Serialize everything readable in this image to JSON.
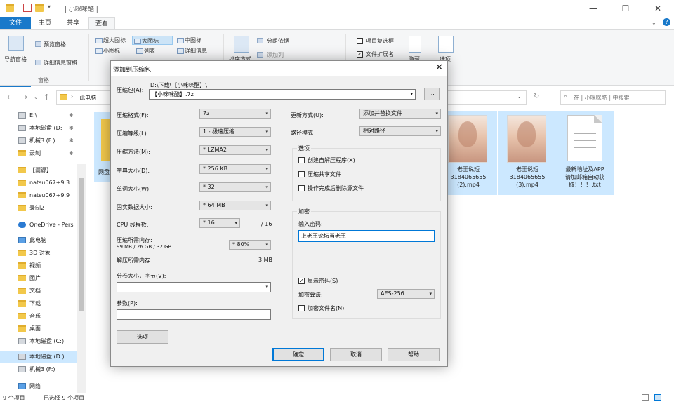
{
  "window": {
    "title": "| 小咪咪酷 |",
    "minimize": "—",
    "maximize": "☐",
    "close": "✕"
  },
  "ribbon": {
    "tabs": [
      "文件",
      "主页",
      "共享",
      "查看"
    ],
    "nav_pane_label": "导航窗格",
    "preview_pane": "预览窗格",
    "details_pane": "详细信息窗格",
    "panes_group": "窗格",
    "layout_items": [
      "超大图标",
      "大图标",
      "中图标",
      "小图标",
      "列表",
      "详细信息"
    ],
    "sort_by": "排序方式",
    "group_by": "分组依据",
    "add_columns": "添加列",
    "item_checkboxes": "项目复选框",
    "file_extensions": "文件扩展名",
    "hide": "隐藏",
    "options": "选项"
  },
  "addressbar": {
    "path_root": "此电脑",
    "search_placeholder": "在 | 小咪咪酷 | 中搜索"
  },
  "nav_pane": {
    "items": [
      {
        "label": "E:\\",
        "icon": "drive-icon"
      },
      {
        "label": "本地磁盘 (D:",
        "icon": "drive-icon"
      },
      {
        "label": "机械3 (F:)",
        "icon": "drive-icon"
      },
      {
        "label": "录制",
        "icon": "folder-icon"
      },
      {
        "label": "【鬻源】",
        "icon": "folder-icon"
      },
      {
        "label": "natsu067+9.3",
        "icon": "folder-icon"
      },
      {
        "label": "natsu067+9.9",
        "icon": "folder-icon"
      },
      {
        "label": "录制2",
        "icon": "folder-icon"
      },
      {
        "label": "OneDrive - Pers",
        "icon": "cloud-icon"
      },
      {
        "label": "此电脑",
        "icon": "pc-icon"
      },
      {
        "label": "3D 对象",
        "icon": "folder-icon"
      },
      {
        "label": "视频",
        "icon": "folder-icon"
      },
      {
        "label": "图片",
        "icon": "folder-icon"
      },
      {
        "label": "文档",
        "icon": "folder-icon"
      },
      {
        "label": "下载",
        "icon": "folder-icon"
      },
      {
        "label": "音乐",
        "icon": "folder-icon"
      },
      {
        "label": "桌面",
        "icon": "folder-icon"
      },
      {
        "label": "本地磁盘 (C:)",
        "icon": "drive-icon"
      },
      {
        "label": "本地磁盘 (D:)",
        "icon": "drive-icon"
      },
      {
        "label": "机械3 (F:)",
        "icon": "drive-icon"
      },
      {
        "label": "网络",
        "icon": "network-icon"
      }
    ]
  },
  "files": [
    {
      "name": "网盘",
      "type": "folder"
    },
    {
      "name": "老王说短3184065655(2).mp4",
      "line1": "老王说短",
      "line2": "3184065655",
      "line3": "(2).mp4",
      "type": "video"
    },
    {
      "name": "老王说短3184065655(3).mp4",
      "line1": "老王说短",
      "line2": "3184065655",
      "line3": "(3).mp4",
      "type": "video"
    },
    {
      "name": "最新地址及APP请加邮箱自动获取！！！.txt",
      "line1": "最新地址及APP",
      "line2": "请加邮箱自动获",
      "line3": "取！！！.txt",
      "type": "text"
    }
  ],
  "statusbar": {
    "count": "9 个项目",
    "selected": "已选择 9 个项目"
  },
  "dialog": {
    "title": "添加到压缩包",
    "close": "✕",
    "archive_label": "压缩包(A):",
    "archive_path": "D:\\下载\\【小咪咪酷】\\",
    "archive_name": "【小咪咪酷】.7z",
    "browse": "...",
    "format_label": "压缩格式(F):",
    "format_value": "7z",
    "level_label": "压缩等级(L):",
    "level_value": "1 - 极速压缩",
    "method_label": "压缩方法(M):",
    "method_value": "* LZMA2",
    "dict_label": "字典大小(D):",
    "dict_value": "* 256 KB",
    "word_label": "单词大小(W):",
    "word_value": "* 32",
    "solid_label": "固实数据大小:",
    "solid_value": "* 64 MB",
    "cpu_label": "CPU 线程数:",
    "cpu_value": "* 16",
    "cpu_total": "/ 16",
    "mem_label": "压缩所需内存:",
    "mem_detail": "99 MB / 26 GB / 32 GB",
    "mem_value": "* 80%",
    "decomp_label": "解压所需内存:",
    "decomp_value": "3 MB",
    "split_label": "分卷大小，字节(V):",
    "params_label": "参数(P):",
    "options_btn": "选项",
    "update_label": "更新方式(U):",
    "update_value": "添加并替换文件",
    "path_label": "路径模式",
    "path_value": "相对路径",
    "options_group": "选项",
    "opt_sfx": "创建自解压程序(X)",
    "opt_shared": "压缩共享文件",
    "opt_delete": "操作完成后删除源文件",
    "encrypt_group": "加密",
    "pwd_label": "输入密码:",
    "pwd_value": "上老王论坛当老王",
    "show_pwd": "显示密码(S)",
    "enc_method_label": "加密算法:",
    "enc_method_value": "AES-256",
    "enc_names": "加密文件名(N)",
    "ok": "确定",
    "cancel": "取消",
    "help": "帮助"
  }
}
